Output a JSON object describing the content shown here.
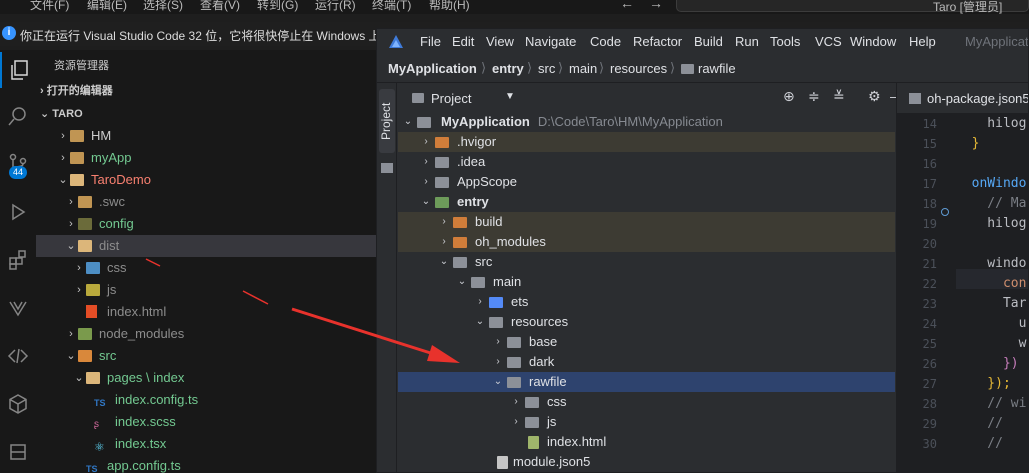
{
  "vscode": {
    "menu": [
      "文件(F)",
      "编辑(E)",
      "选择(S)",
      "查看(V)",
      "转到(G)",
      "运行(R)",
      "终端(T)",
      "帮助(H)"
    ],
    "search_text": "Taro [管理员]",
    "banner": "你正在运行 Visual Studio Code 32 位，它将很快停止在 Windows 上",
    "activity_badge": "44",
    "explorer_title": "资源管理器",
    "sections": {
      "open_editors": "打开的编辑器",
      "root": "TARO"
    },
    "tree": [
      {
        "label": "HM",
        "color": "#cccccc"
      },
      {
        "label": "myApp",
        "color": "#73c991"
      },
      {
        "label": "TaroDemo",
        "color": "#f88070"
      },
      {
        "label": ".swc",
        "color": "#8c8c8c"
      },
      {
        "label": "config",
        "color": "#73c991"
      },
      {
        "label": "dist",
        "color": "#8c8c8c"
      },
      {
        "label": "css",
        "color": "#8c8c8c"
      },
      {
        "label": "js",
        "color": "#8c8c8c"
      },
      {
        "label": "index.html",
        "color": "#8c8c8c"
      },
      {
        "label": "node_modules",
        "color": "#8c8c8c"
      },
      {
        "label": "src",
        "color": "#73c991"
      },
      {
        "label": "pages",
        "label2": "index",
        "color": "#73c991"
      },
      {
        "label": "index.config.ts",
        "color": "#73c991"
      },
      {
        "label": "index.scss",
        "color": "#73c991"
      },
      {
        "label": "index.tsx",
        "color": "#73c991"
      },
      {
        "label": "app.config.ts",
        "color": "#73c991"
      }
    ]
  },
  "ide": {
    "menu": [
      "File",
      "Edit",
      "View",
      "Navigate",
      "Code",
      "Refactor",
      "Build",
      "Run",
      "Tools",
      "VCS",
      "Window",
      "Help"
    ],
    "project_name_faded": "MyApplicat",
    "breadcrumb": [
      "MyApplication",
      "entry",
      "src",
      "main",
      "resources",
      "rawfile"
    ],
    "side_tab": "Project",
    "project_header": "Project",
    "editor_tab": "oh-package.json5",
    "tree": [
      {
        "label": "MyApplication",
        "path": "D:\\Code\\Taro\\HM\\MyApplication"
      },
      {
        "label": ".hvigor"
      },
      {
        "label": ".idea"
      },
      {
        "label": "AppScope"
      },
      {
        "label": "entry"
      },
      {
        "label": "build"
      },
      {
        "label": "oh_modules"
      },
      {
        "label": "src"
      },
      {
        "label": "main"
      },
      {
        "label": "ets"
      },
      {
        "label": "resources"
      },
      {
        "label": "base"
      },
      {
        "label": "dark"
      },
      {
        "label": "rawfile"
      },
      {
        "label": "css"
      },
      {
        "label": "js"
      },
      {
        "label": "index.html"
      },
      {
        "label": "module.json5"
      }
    ],
    "line_numbers": [
      "14",
      "15",
      "16",
      "17",
      "18",
      "19",
      "20",
      "21",
      "22",
      "23",
      "24",
      "25",
      "26",
      "27",
      "28",
      "29",
      "30"
    ],
    "code_lines": [
      "    hilog",
      "  }",
      "",
      "  onWindo",
      "    // Ma",
      "    hilog",
      "",
      "    windo",
      "      con",
      "      Tar",
      "        u",
      "        w",
      "      })",
      "    });",
      "    // wi",
      "    //",
      "    //"
    ]
  },
  "colors": {
    "accent": "#0078d4",
    "selection": "#2e436e",
    "excluded": "#3d3b33",
    "arrow": "#e8322c"
  }
}
